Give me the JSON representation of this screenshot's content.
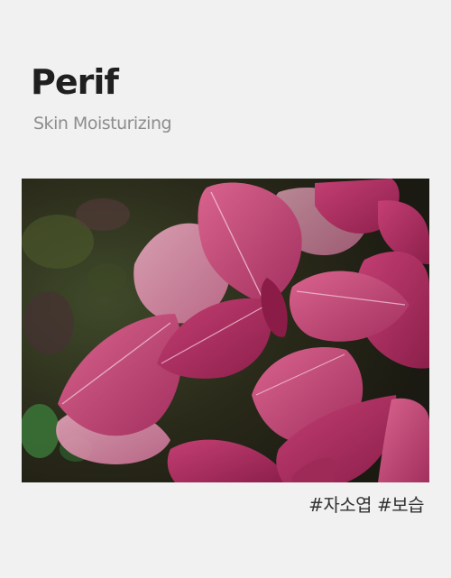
{
  "product": {
    "name": "Perif",
    "subtitle": "Skin Moisturizing"
  },
  "image": {
    "subject": "purple-perilla-leaves"
  },
  "tags": "#자소엽 #보습",
  "colors": {
    "background": "#f1f1f1",
    "title": "#1f1f1f",
    "subtitle": "#8d8d8d",
    "leaf_primary": "#a52a5c",
    "leaf_light": "#d98aa6"
  }
}
